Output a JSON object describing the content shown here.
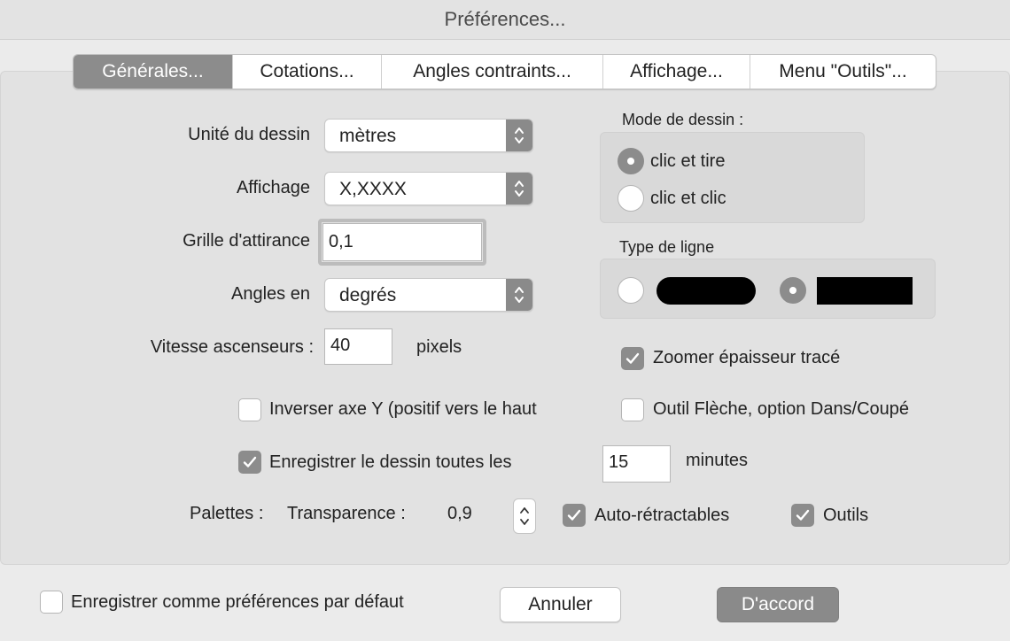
{
  "window": {
    "title": "Préférences..."
  },
  "tabs": [
    {
      "label": "Générales...",
      "active": true
    },
    {
      "label": "Cotations...",
      "active": false
    },
    {
      "label": "Angles contraints...",
      "active": false
    },
    {
      "label": "Affichage...",
      "active": false
    },
    {
      "label": "Menu \"Outils\"...",
      "active": false
    }
  ],
  "fields": {
    "unit": {
      "label": "Unité du dessin",
      "value": "mètres"
    },
    "display": {
      "label": "Affichage",
      "value": "X,XXXX"
    },
    "grid": {
      "label": "Grille d'attirance",
      "value": "0,1"
    },
    "angles": {
      "label": "Angles en",
      "value": "degrés"
    },
    "scroll": {
      "label": "Vitesse ascenseurs :",
      "value": "40",
      "unit": "pixels"
    }
  },
  "draw_mode": {
    "title": "Mode de dessin :",
    "options": [
      {
        "label": "clic et tire",
        "checked": true
      },
      {
        "label": "clic et clic",
        "checked": false
      }
    ]
  },
  "line_type": {
    "title": "Type de ligne",
    "options": [
      {
        "name": "rounded",
        "checked": false
      },
      {
        "name": "square",
        "checked": true
      }
    ]
  },
  "checkboxes": {
    "zoom": {
      "label": "Zoomer épaisseur tracé",
      "checked": true
    },
    "invert_y": {
      "label": "Inverser axe Y (positif vers le haut",
      "checked": false
    },
    "arrow_tool": {
      "label": "Outil Flèche, option Dans/Coupé",
      "checked": false
    },
    "autosave": {
      "label": "Enregistrer le dessin toutes les",
      "checked": true,
      "value": "15",
      "unit": "minutes"
    },
    "auto_retract": {
      "label": "Auto-rétractables",
      "checked": true
    },
    "tools": {
      "label": "Outils",
      "checked": true
    },
    "save_default": {
      "label": "Enregistrer comme préférences par défaut",
      "checked": false
    }
  },
  "palettes": {
    "label": "Palettes :",
    "transparency_label": "Transparence :",
    "transparency_value": "0,9"
  },
  "buttons": {
    "cancel": "Annuler",
    "ok": "D'accord"
  },
  "colors": {
    "accent": "#8c8c8c",
    "background": "#ebebeb"
  }
}
